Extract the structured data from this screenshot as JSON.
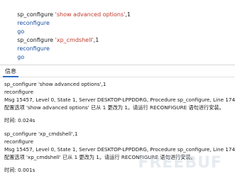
{
  "editor": {
    "lines": [
      {
        "pre": "sp_configure ",
        "str": "'show advanced options'",
        "post": ",1"
      },
      {
        "kw": "reconfigure"
      },
      {
        "kw": "go"
      },
      {
        "pre": "sp_configure ",
        "str": "'xp_cmdshell'",
        "post": ",1"
      },
      {
        "kw": "reconfigure"
      },
      {
        "kw": "go"
      }
    ]
  },
  "tabs": {
    "messages_label": "信息"
  },
  "messages": {
    "lines": [
      "sp_configure 'show advanced options',1",
      "reconfigure",
      "Msg 15457, Level 0, State 1, Server DESKTOP-LPPDDRG, Procedure sp_configure, Line 174",
      "配置选项 'show advanced options' 已从 1 更改为 1。请运行 RECONFIGURE 语句进行安装。",
      "时间: 0.024s",
      "sp_configure 'xp_cmdshell',1",
      "reconfigure",
      "Msg 15457, Level 0, State 1, Server DESKTOP-LPPDDRG, Procedure sp_configure, Line 174",
      "配置选项 'xp_cmdshell' 已从 1 更改为 1。请运行 RECONFIGURE 语句进行安装。",
      "时间: 0.001s"
    ]
  },
  "watermark": {
    "text": "FREEBUF"
  }
}
